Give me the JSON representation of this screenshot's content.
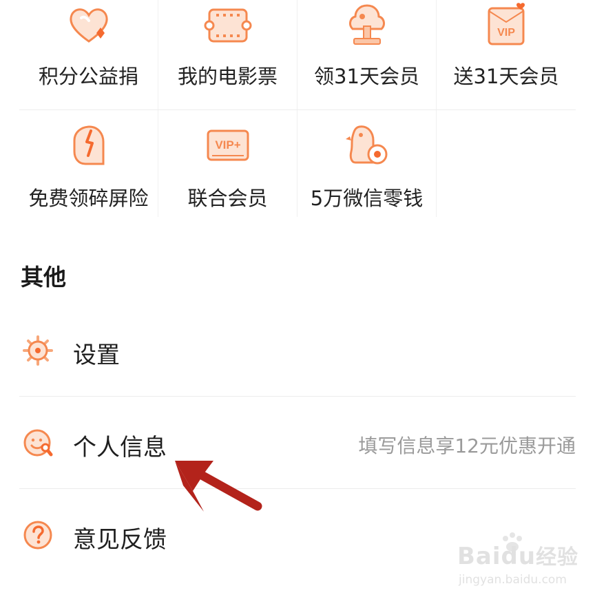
{
  "services": {
    "row1": [
      {
        "label": "积分公益捐",
        "icon": "heart-charity-icon"
      },
      {
        "label": "我的电影票",
        "icon": "movie-ticket-icon"
      },
      {
        "label": "领31天会员",
        "icon": "tree-gift-icon"
      },
      {
        "label": "送31天会员",
        "icon": "vip-envelope-icon"
      }
    ],
    "row2": [
      {
        "label": "免费领碎屏险",
        "icon": "screen-insurance-icon"
      },
      {
        "label": "联合会员",
        "icon": "vip-plus-icon"
      },
      {
        "label": "5万微信零钱",
        "icon": "penguin-coin-icon"
      }
    ]
  },
  "other": {
    "title": "其他",
    "items": [
      {
        "label": "设置",
        "icon": "gear-icon"
      },
      {
        "label": "个人信息",
        "hint": "填写信息享12元优惠开通",
        "icon": "smile-wrench-icon"
      },
      {
        "label": "意见反馈",
        "icon": "question-icon"
      }
    ]
  },
  "watermark": {
    "brand": "Bai",
    "brand_mid": "du",
    "brand_cn": "经验",
    "url": "jingyan.baidu.com"
  },
  "colors": {
    "accent": "#f5884f",
    "accent_light": "#fbd3bd",
    "annotation": "#b3231b",
    "hint_text": "#9a9a9a"
  }
}
